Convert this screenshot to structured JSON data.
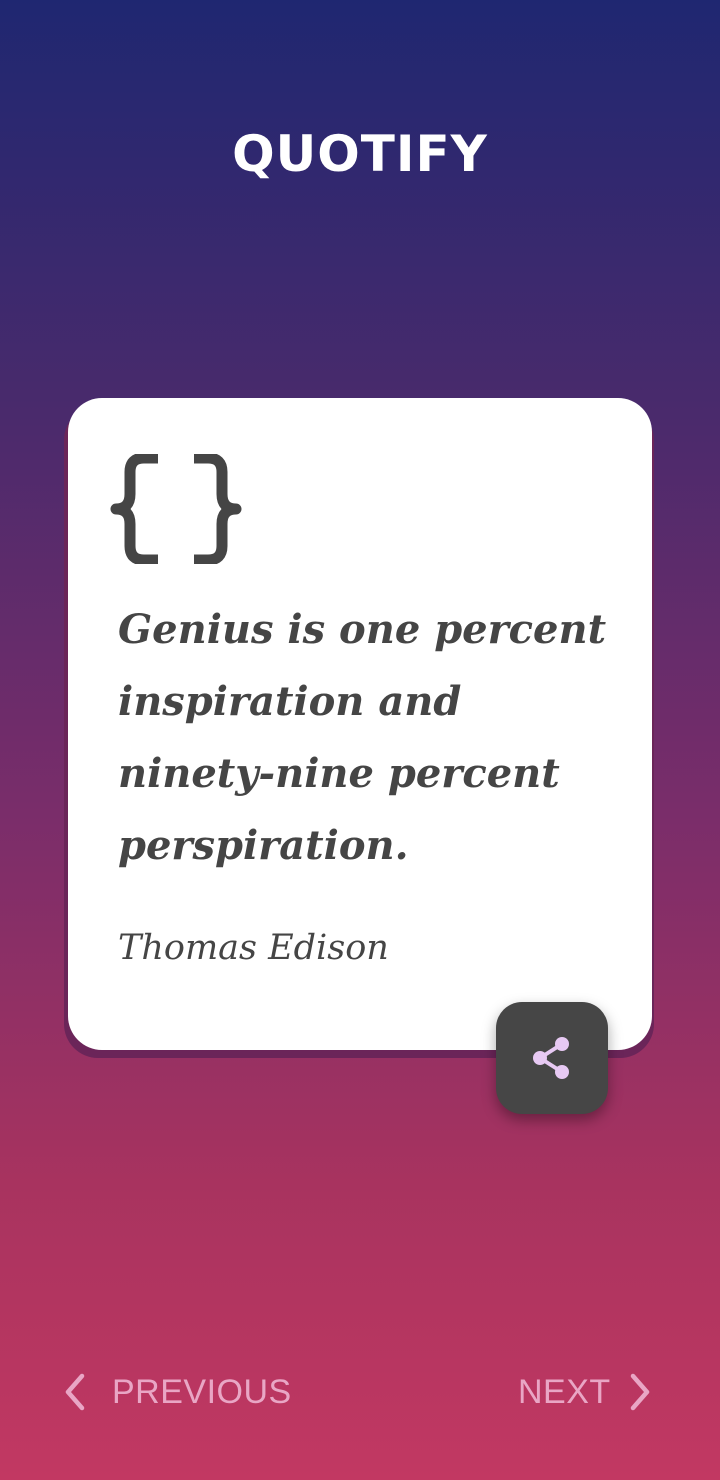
{
  "app": {
    "title": "QUOTIFY"
  },
  "quote": {
    "text": "Genius is one percent inspiration and ninety-nine percent perspiration.",
    "author": "Thomas Edison",
    "icon": "curly-braces-icon"
  },
  "actions": {
    "share_icon": "share-icon"
  },
  "navigation": {
    "previous_label": "PREVIOUS",
    "next_label": "NEXT",
    "previous_icon": "chevron-left-icon",
    "next_icon": "chevron-right-icon"
  },
  "colors": {
    "gradient_top": "#1f2771",
    "gradient_bottom": "#c23862",
    "card_background": "#ffffff",
    "text_dark": "#454545",
    "share_button": "#464646",
    "share_icon": "#e7c9f3",
    "nav_text": "#e9a6c5"
  }
}
